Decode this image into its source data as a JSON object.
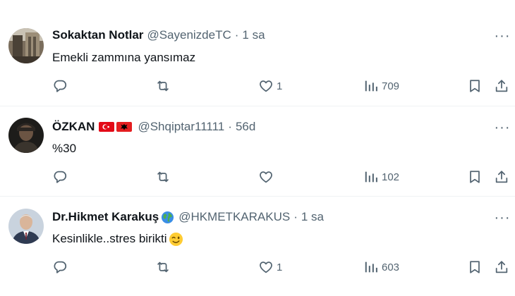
{
  "tweets": [
    {
      "name": "Sokaktan Notlar",
      "handle": "@SayenizdeTC",
      "separator": "·",
      "time": "1 sa",
      "text": "Emekli zammına yansımaz",
      "replies": "",
      "retweets": "",
      "likes": "1",
      "views": "709",
      "avatar_icon": "street-photo-avatar"
    },
    {
      "name": "ÖZKAN",
      "badges": [
        "turkey-flag-icon",
        "albania-flag-icon"
      ],
      "handle": "@Shqiptar11111",
      "separator": "·",
      "time": "56d",
      "text": "%30",
      "replies": "",
      "retweets": "",
      "likes": "",
      "views": "102",
      "avatar_icon": "dark-portrait-avatar"
    },
    {
      "name": "Dr.Hikmet Karakuş",
      "badges": [
        "globe-emoji-icon"
      ],
      "handle": "@HKMETKARAKUS",
      "separator": "·",
      "time": "1 sa",
      "text": "Kesinlikle..stres birikti",
      "text_emoji": "winking-face-emoji",
      "replies": "",
      "retweets": "",
      "likes": "1",
      "views": "603",
      "avatar_icon": "man-in-suit-avatar"
    }
  ],
  "colors": {
    "text": "#0f1419",
    "secondary": "#536471",
    "divider": "#eff3f4",
    "background": "#ffffff"
  },
  "icons": {
    "more": "more-dots-icon",
    "reply": "reply-icon",
    "retweet": "retweet-icon",
    "like": "like-heart-icon",
    "views": "views-bar-icon",
    "bookmark": "bookmark-icon",
    "share": "share-icon"
  }
}
